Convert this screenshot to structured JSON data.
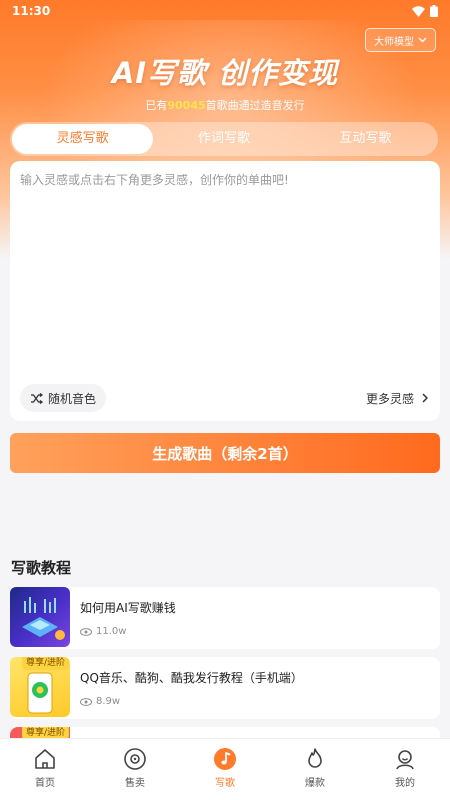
{
  "status": {
    "time": "11:30"
  },
  "header": {
    "model_label": "大师模型",
    "title": "AI写歌 创作变现",
    "subtitle_prefix": "已有",
    "subtitle_count": "90045",
    "subtitle_suffix": "首歌曲通过造音发行"
  },
  "tabs": [
    {
      "label": "灵感写歌"
    },
    {
      "label": "作词写歌"
    },
    {
      "label": "互动写歌"
    }
  ],
  "editor": {
    "placeholder": "输入灵感或点击右下角更多灵感，创作你的单曲吧!",
    "random_voice_label": "随机音色",
    "more_label": "更多灵感"
  },
  "generate_button": "生成歌曲（剩余2首）",
  "tutorials": {
    "title": "写歌教程",
    "items": [
      {
        "title": "如何用AI写歌赚钱",
        "views": "11.0w",
        "badge": ""
      },
      {
        "title": "QQ音乐、酷狗、酷我发行教程（手机端）",
        "views": "8.9w",
        "badge": "尊享/进阶"
      },
      {
        "title": "",
        "views": "",
        "badge": "尊享/进阶"
      }
    ]
  },
  "nav": [
    {
      "label": "首页",
      "icon": "home-icon"
    },
    {
      "label": "售卖",
      "icon": "vinyl-disc-icon"
    },
    {
      "label": "写歌",
      "icon": "music-note-icon"
    },
    {
      "label": "爆款",
      "icon": "flame-icon"
    },
    {
      "label": "我的",
      "icon": "user-icon"
    }
  ],
  "colors": {
    "accent": "#ff7a2a",
    "highlight": "#ffe34a"
  }
}
